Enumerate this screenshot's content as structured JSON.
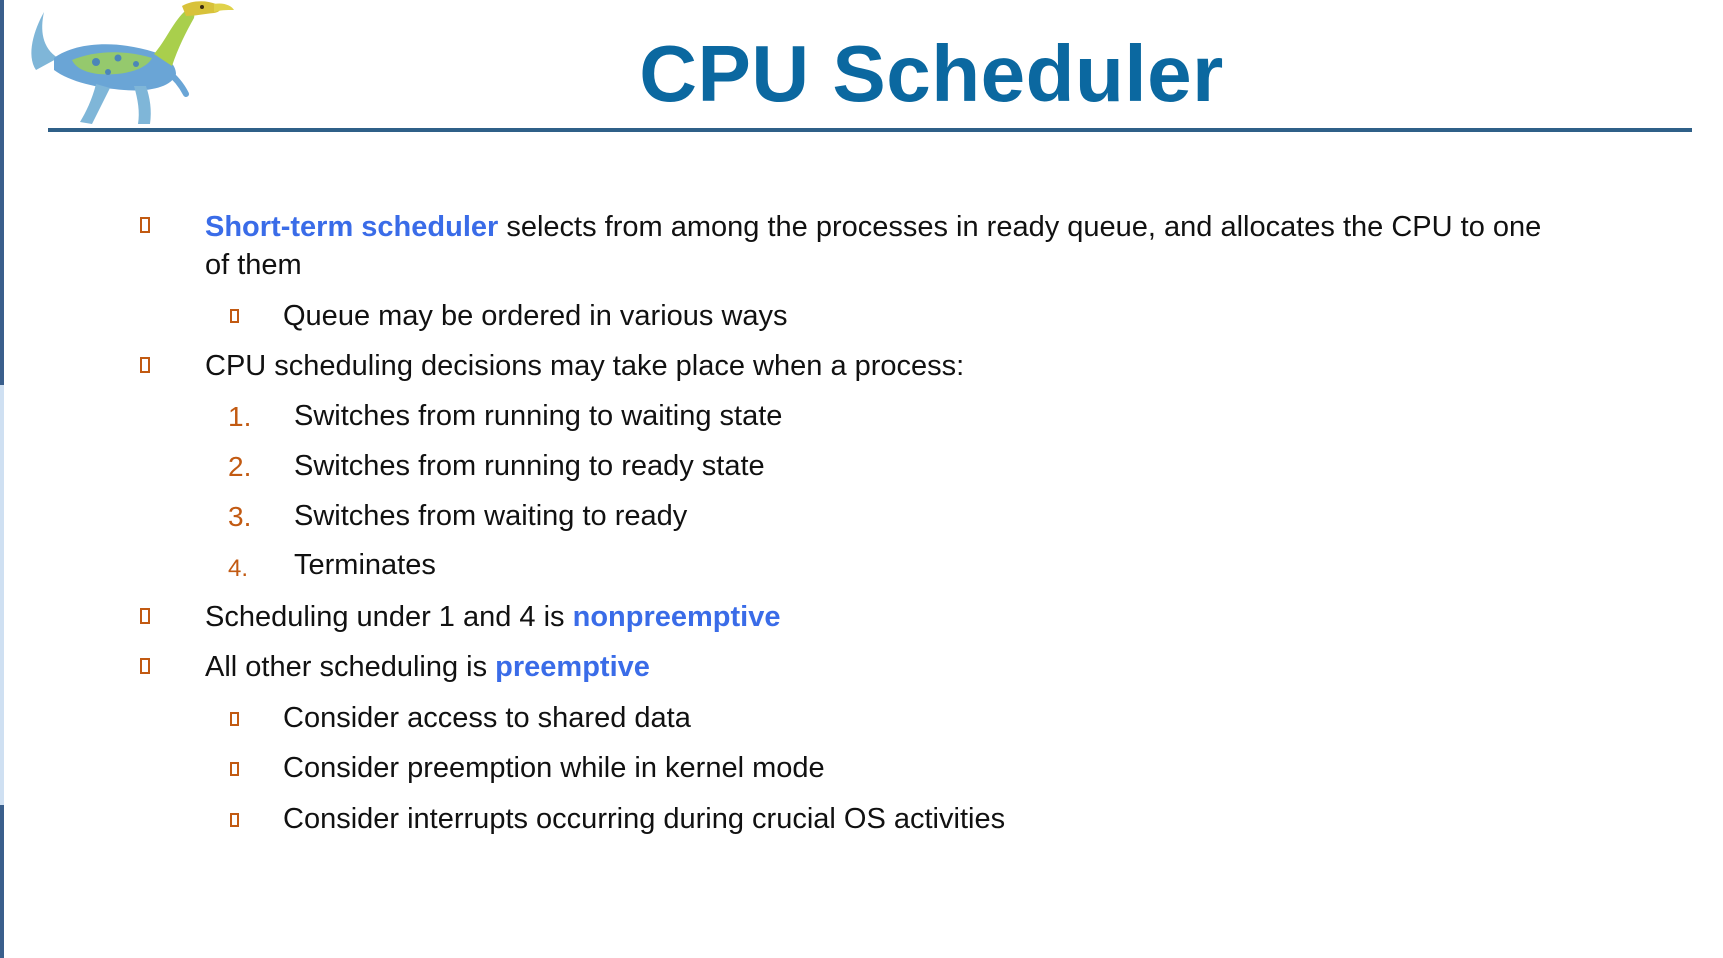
{
  "slide": {
    "title": "CPU Scheduler",
    "logo_icon": "dinosaur-logo",
    "accent_color": "#0b68a0",
    "highlight_color": "#3a6ce8",
    "bullet_color": "#c25a12"
  },
  "bullets": {
    "b1": {
      "highlight": "Short-term scheduler",
      "text_line1": " selects from among the processes in ready queue, and allocates the CPU to one",
      "text_line2": "of them"
    },
    "b1_sub1": "Queue may be ordered in various ways",
    "b2": "CPU scheduling decisions may take place when a process:",
    "numbered": [
      {
        "num": "1.",
        "text": "Switches from running to waiting state"
      },
      {
        "num": "2.",
        "text": "Switches from running to ready state"
      },
      {
        "num": "3.",
        "text": "Switches from waiting to ready"
      },
      {
        "num": "4.",
        "text": "Terminates"
      }
    ],
    "b3": {
      "text": "Scheduling under 1 and 4 is ",
      "highlight": "nonpreemptive"
    },
    "b4": {
      "text": "All other scheduling is ",
      "highlight": "preemptive"
    },
    "b4_subs": [
      "Consider access to shared data",
      "Consider preemption while in kernel mode",
      "Consider interrupts occurring during crucial OS activities"
    ]
  }
}
